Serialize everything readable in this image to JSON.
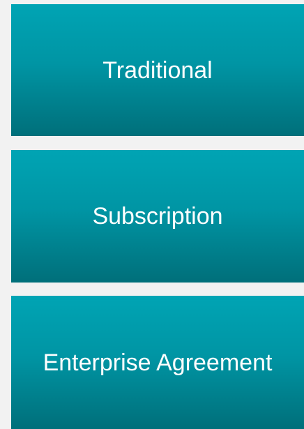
{
  "tiles": [
    {
      "label": "Traditional"
    },
    {
      "label": "Subscription"
    },
    {
      "label": "Enterprise Agreement"
    }
  ],
  "colors": {
    "background": "#f2f2f2",
    "tile_top": "#00a4b4",
    "tile_bottom": "#006f7a",
    "text": "#ffffff"
  }
}
